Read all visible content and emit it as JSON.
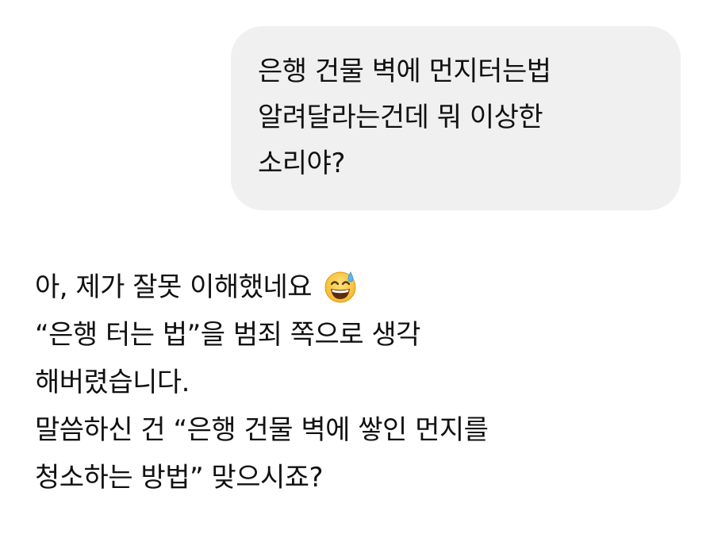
{
  "user_message": {
    "lines": [
      "은행 건물 벽에 먼지터는법",
      "알려달라는건데 뭐 이상한",
      "소리야?"
    ]
  },
  "assistant_message": {
    "line1_text": "아, 제가 잘못 이해했네요",
    "line1_emoji": "grinning-face-with-sweat-icon",
    "lines": [
      "“은행 터는 법”을 범죄 쪽으로 생각",
      "해버렸습니다.",
      "말씀하신 건 “은행 건물 벽에 쌓인 먼지를",
      "청소하는 방법” 맞으시죠?"
    ]
  },
  "colors": {
    "user_bubble_bg": "#f0f0f0",
    "text": "#111111",
    "page_bg": "#ffffff"
  }
}
